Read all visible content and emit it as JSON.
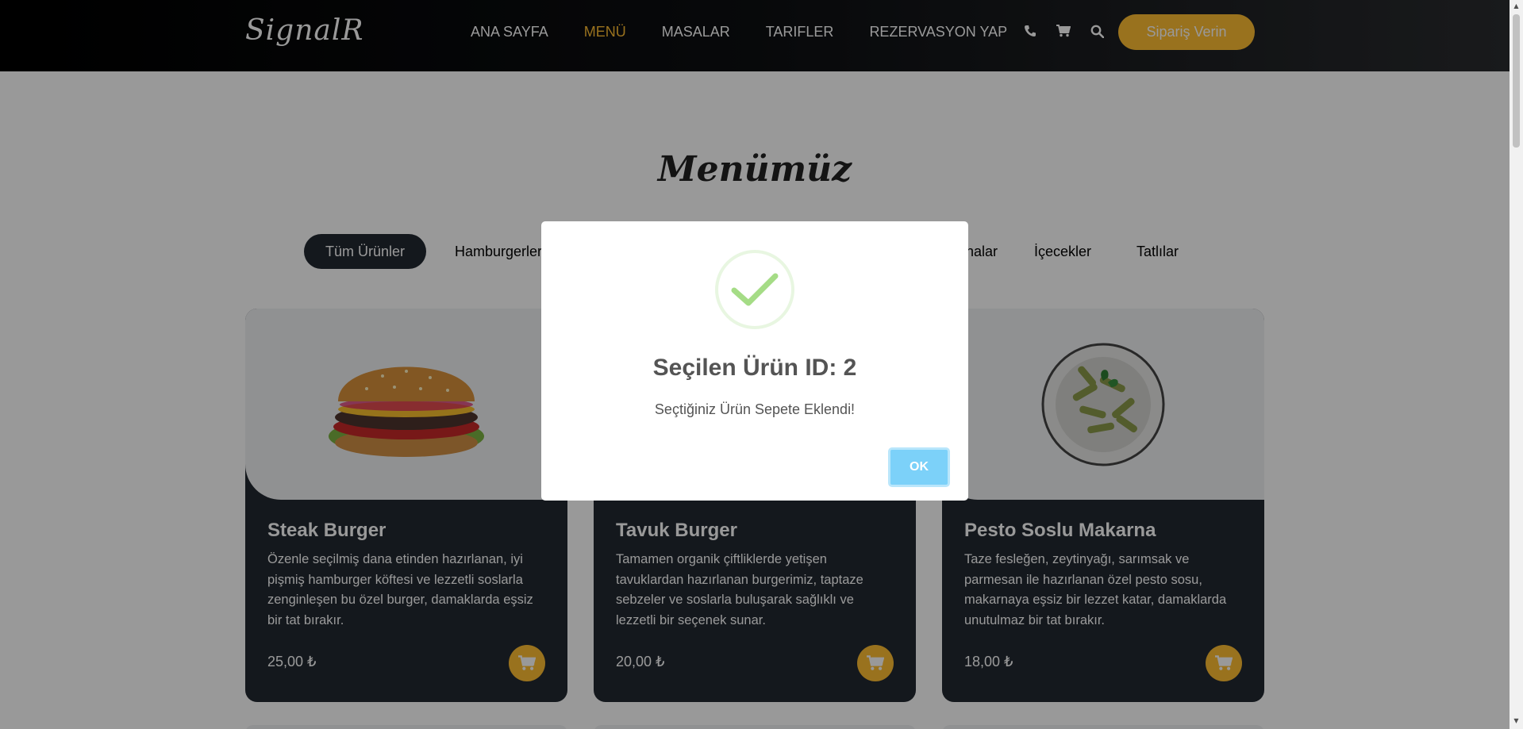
{
  "header": {
    "logo": "SignalR",
    "nav": [
      {
        "label": "ANA SAYFA",
        "active": false
      },
      {
        "label": "MENÜ",
        "active": true
      },
      {
        "label": "MASALAR",
        "active": false
      },
      {
        "label": "TARIFLER",
        "active": false
      },
      {
        "label": "REZERVASYON YAP",
        "active": false
      }
    ],
    "icons": [
      "phone-icon",
      "cart-icon",
      "search-icon"
    ],
    "order_button": "Sipariş Verin"
  },
  "menu": {
    "title": "Menümüz",
    "filters": [
      {
        "label": "Tüm Ürünler",
        "active": true
      },
      {
        "label": "Hamburgerler",
        "active": false
      },
      {
        "label": "Makarnalar",
        "active": false
      },
      {
        "label": "İçecekler",
        "active": false
      },
      {
        "label": "Tatlılar",
        "active": false
      }
    ],
    "products": [
      {
        "name": "Steak Burger",
        "description": "Özenle seçilmiş dana etinden hazırlanan, iyi pişmiş hamburger köftesi ve lezzetli soslarla zenginleşen bu özel burger, damaklarda eşsiz bir tat bırakır.",
        "price": "25,00 ₺",
        "image": "burger-image"
      },
      {
        "name": "Tavuk Burger",
        "description": "Tamamen organik çiftliklerde yetişen tavuklardan hazırlanan burgerimiz, taptaze sebzeler ve soslarla buluşarak sağlıklı ve lezzetli bir seçenek sunar.",
        "price": "20,00 ₺",
        "image": "chicken-burger-image"
      },
      {
        "name": "Pesto Soslu Makarna",
        "description": "Taze fesleğen, zeytinyağı, sarımsak ve parmesan ile hazırlanan özel pesto sosu, makarnaya eşsiz bir lezzet katar, damaklarda unutulmaz bir tat bırakır.",
        "price": "18,00 ₺",
        "image": "pesto-pasta-image"
      }
    ]
  },
  "modal": {
    "title": "Seçilen Ürün ID: 2",
    "text": "Seçtiğiniz Ürün Sepete Eklendi!",
    "ok_label": "OK",
    "icon": "success-check-icon"
  },
  "colors": {
    "accent": "#ffbe33",
    "dark": "#222831",
    "ok_button": "#7cd1f9",
    "success": "#a5dc86"
  }
}
